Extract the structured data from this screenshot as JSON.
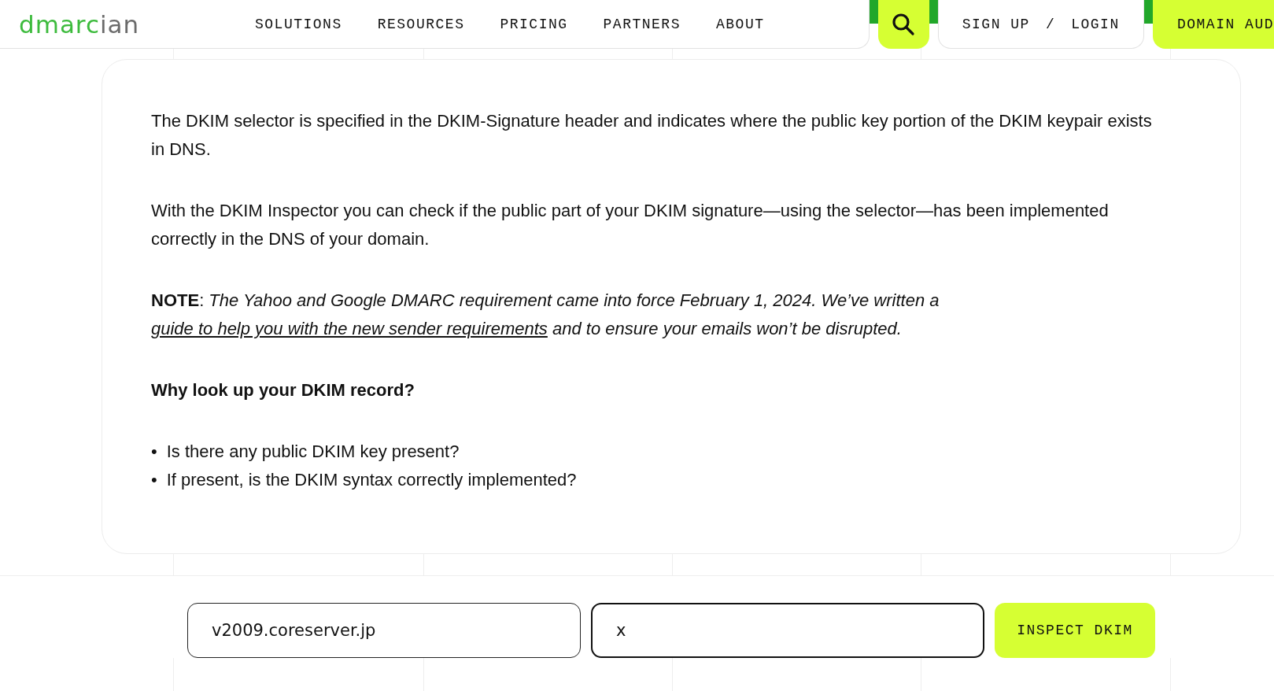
{
  "logo": {
    "parts": [
      "dmarc",
      "ian"
    ]
  },
  "nav": {
    "items": [
      "SOLUTIONS",
      "RESOURCES",
      "PRICING",
      "PARTNERS",
      "ABOUT"
    ]
  },
  "account": {
    "sign_up": "SIGN UP",
    "separator": "/",
    "login": "LOGIN"
  },
  "cta": {
    "label": "DOMAIN AUD"
  },
  "content": {
    "paragraphs": [
      "The DKIM selector is specified in the DKIM-Signature header and indicates where the public key portion of the DKIM keypair exists in DNS.",
      "With the DKIM Inspector you can check if the public part of your DKIM signature—using the selector—has been implemented correctly in the DNS of your domain."
    ],
    "note": {
      "label": "NOTE",
      "separator": ":",
      "before": "The Yahoo and Google DMARC requirement came into force February 1, 2024. We’ve written a",
      "link": "guide to help you with the new sender requirements",
      "after": "and to ensure your emails won’t be disrupted."
    },
    "heading": "Why look up your DKIM record?",
    "bullets": [
      {
        "marker": "•",
        "text": "Is there any public DKIM key present?"
      },
      {
        "marker": "•",
        "text": "If present, is the DKIM syntax correctly implemented?"
      }
    ]
  },
  "form": {
    "fields": [
      {
        "value": "v2009.coreserver.jp",
        "focused": false
      },
      {
        "value": "x",
        "focused": true
      }
    ],
    "button": "INSPECT DKIM"
  }
}
